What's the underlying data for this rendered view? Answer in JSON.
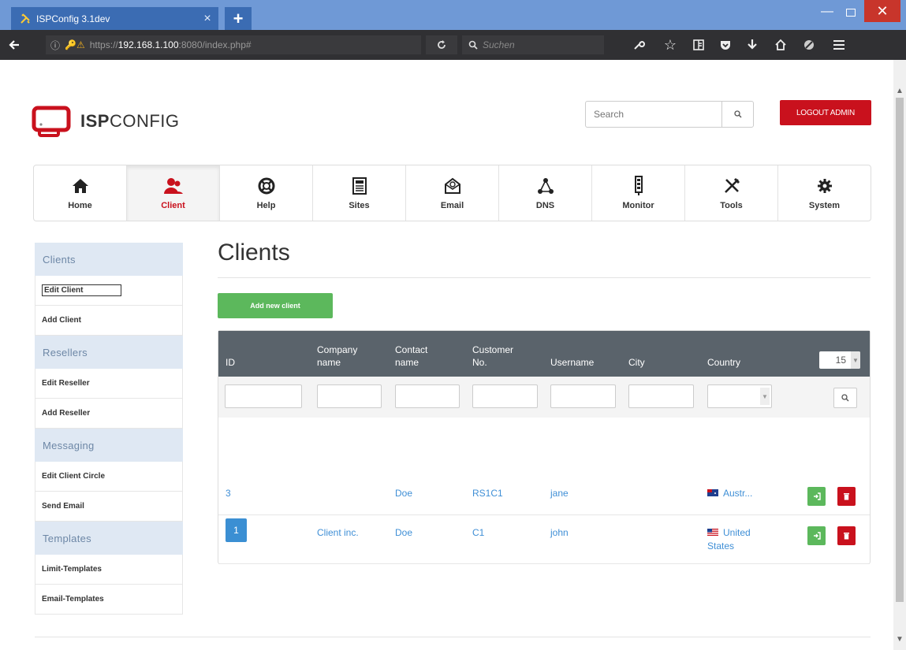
{
  "browser": {
    "tab_title": "ISPConfig 3.1dev",
    "tab_close": "×",
    "new_tab": "+",
    "url_prefix": "https://",
    "url_host": "192.168.1.100",
    "url_rest": ":8080/index.php#",
    "search_placeholder": "Suchen",
    "win_min": "—",
    "win_close": "✕"
  },
  "header": {
    "logo_bold": "ISP",
    "logo_light": "CONFIG",
    "search_placeholder": "Search",
    "logout_label": "LOGOUT ADMIN"
  },
  "nav": {
    "items": [
      {
        "label": "Home",
        "icon": "home-icon"
      },
      {
        "label": "Client",
        "icon": "client-icon"
      },
      {
        "label": "Help",
        "icon": "help-icon"
      },
      {
        "label": "Sites",
        "icon": "sites-icon"
      },
      {
        "label": "Email",
        "icon": "email-icon"
      },
      {
        "label": "DNS",
        "icon": "dns-icon"
      },
      {
        "label": "Monitor",
        "icon": "monitor-icon"
      },
      {
        "label": "Tools",
        "icon": "tools-icon"
      },
      {
        "label": "System",
        "icon": "system-icon"
      }
    ],
    "active": "Client"
  },
  "sidebar": {
    "sections": [
      {
        "title": "Clients",
        "items": [
          "Edit Client",
          "Add Client"
        ]
      },
      {
        "title": "Resellers",
        "items": [
          "Edit Reseller",
          "Add Reseller"
        ]
      },
      {
        "title": "Messaging",
        "items": [
          "Edit Client Circle",
          "Send Email"
        ]
      },
      {
        "title": "Templates",
        "items": [
          "Limit-Templates",
          "Email-Templates"
        ]
      }
    ]
  },
  "main": {
    "title": "Clients",
    "add_button": "Add new client",
    "columns": {
      "id": "ID",
      "company_1": "Company",
      "company_2": "name",
      "contact_1": "Contact",
      "contact_2": "name",
      "customer_1": "Customer",
      "customer_2": "No.",
      "username": "Username",
      "city": "City",
      "country": "Country"
    },
    "per_page": "15",
    "rows": [
      {
        "id": "3",
        "company": "",
        "contact": "Doe",
        "customer_no": "RS1C1",
        "username": "jane",
        "city": "",
        "country_1": "Austr...",
        "country_2": ""
      },
      {
        "id": "1",
        "company": "Client inc.",
        "contact": "Doe",
        "customer_no": "C1",
        "username": "john",
        "city": "",
        "country_1": "United",
        "country_2": "States"
      }
    ],
    "pages": [
      "1"
    ]
  },
  "colors": {
    "accent_red": "#c9111d",
    "green": "#5cb85c",
    "link_blue": "#3f8fd6",
    "header_gray": "#5a636b",
    "sidebar_head": "#dfe8f3"
  }
}
